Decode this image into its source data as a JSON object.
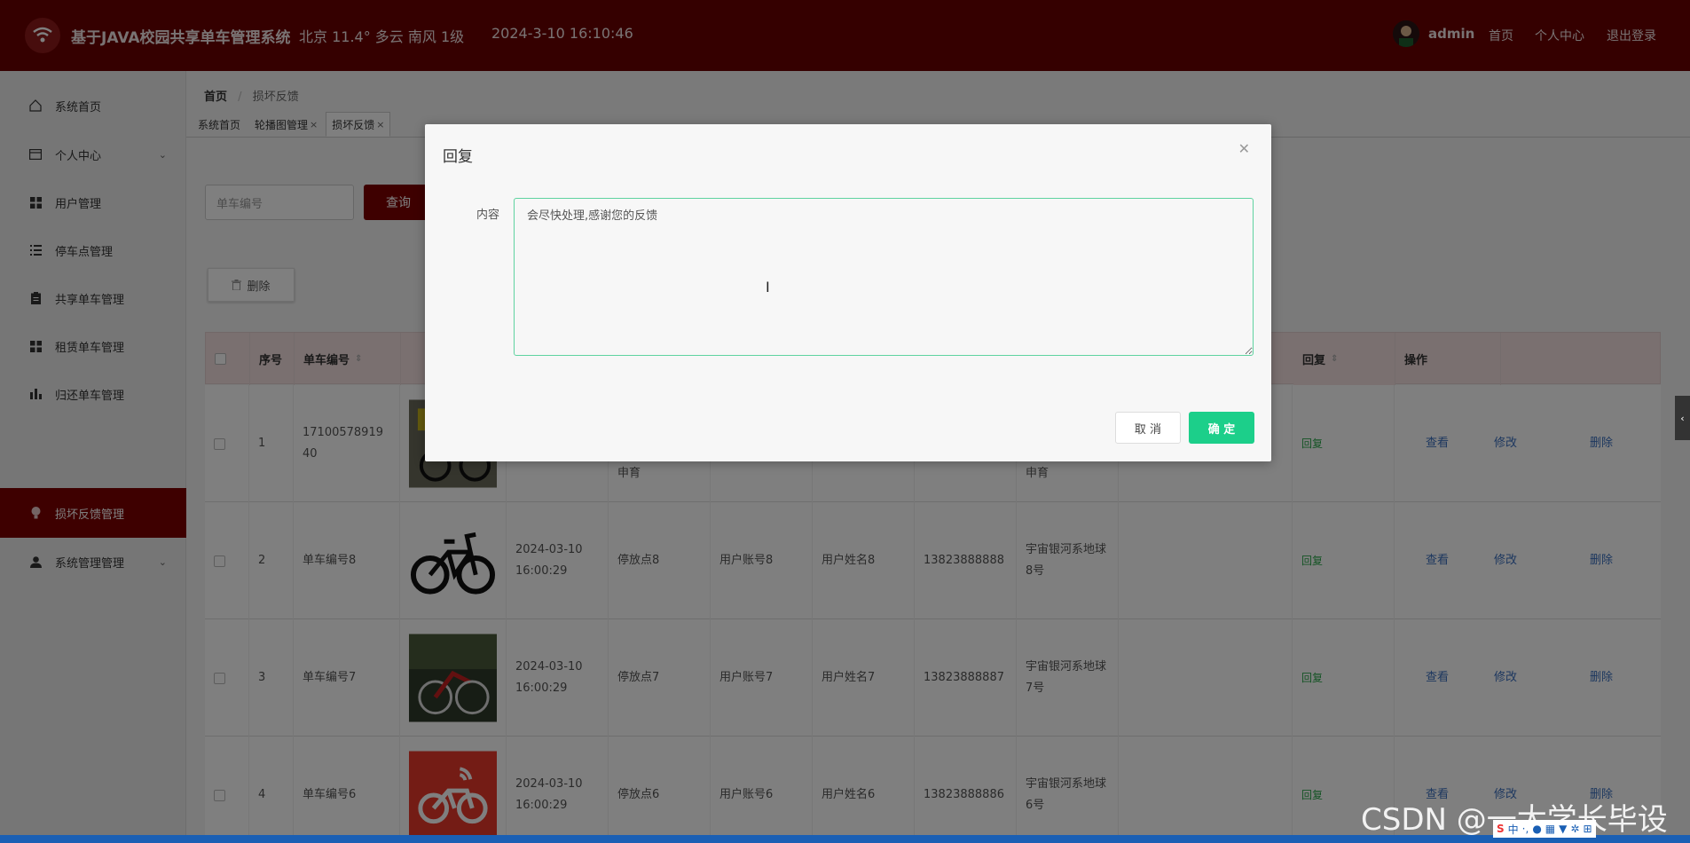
{
  "header": {
    "title": "基于JAVA校园共享单车管理系统",
    "weather": "北京  11.4°  多云  南风  1级",
    "datetime": "2024-3-10 16:10:46",
    "user": "admin",
    "links": [
      "首页",
      "个人中心",
      "退出登录"
    ]
  },
  "sidebar": {
    "items": [
      {
        "label": "系统首页",
        "icon": "home-icon"
      },
      {
        "label": "个人中心",
        "icon": "card-icon",
        "expandable": true
      },
      {
        "label": "用户管理",
        "icon": "grid-icon"
      },
      {
        "label": "停车点管理",
        "icon": "list-icon"
      },
      {
        "label": "共享单车管理",
        "icon": "clipboard-icon"
      },
      {
        "label": "租赁单车管理",
        "icon": "grid-icon"
      },
      {
        "label": "归还单车管理",
        "icon": "bar-chart-icon"
      },
      {
        "label": "损坏反馈管理",
        "icon": "bulb-icon",
        "active": true
      },
      {
        "label": "系统管理管理",
        "icon": "user-icon",
        "expandable": true
      }
    ]
  },
  "breadcrumb": {
    "home": "首页",
    "sep": "/",
    "current": "损坏反馈"
  },
  "tabs": [
    {
      "label": "系统首页",
      "closable": false
    },
    {
      "label": "轮播图管理",
      "closable": true
    },
    {
      "label": "损坏反馈",
      "closable": true,
      "active": true
    }
  ],
  "search": {
    "placeholder": "单车编号",
    "button": "查询"
  },
  "toolbar": {
    "delete": "删除"
  },
  "table": {
    "headers": {
      "index": "序号",
      "bike_no": "单车编号",
      "reply": "回复",
      "ops": "操作"
    },
    "rows": [
      {
        "index": "1",
        "bike_no": "1710057891940",
        "time": "",
        "point": "申育",
        "account": "",
        "name": "",
        "phone": "",
        "address": "申育",
        "reply": "回复"
      },
      {
        "index": "2",
        "bike_no": "单车编号8",
        "time": "2024-03-10 16:00:29",
        "point": "停放点8",
        "account": "用户账号8",
        "name": "用户姓名8",
        "phone": "13823888888",
        "address": "宇宙银河系地球8号",
        "reply": "回复"
      },
      {
        "index": "3",
        "bike_no": "单车编号7",
        "time": "2024-03-10 16:00:29",
        "point": "停放点7",
        "account": "用户账号7",
        "name": "用户姓名7",
        "phone": "13823888887",
        "address": "宇宙银河系地球7号",
        "reply": "回复"
      },
      {
        "index": "4",
        "bike_no": "单车编号6",
        "time": "2024-03-10 16:00:29",
        "point": "停放点6",
        "account": "用户账号6",
        "name": "用户姓名6",
        "phone": "13823888886",
        "address": "宇宙银河系地球6号",
        "reply": "回复"
      }
    ],
    "ops": [
      "查看",
      "修改",
      "删除"
    ]
  },
  "modal": {
    "title": "回复",
    "label": "内容",
    "value": "会尽快处理,感谢您的反馈",
    "cancel": "取 消",
    "confirm": "确 定"
  },
  "watermark": "CSDN @一太学长毕设",
  "colors": {
    "brand": "#6b0000",
    "active": "#7d0000",
    "confirm": "#1ccf8a",
    "reply": "#2aa84a",
    "link": "#3a6fbf"
  }
}
